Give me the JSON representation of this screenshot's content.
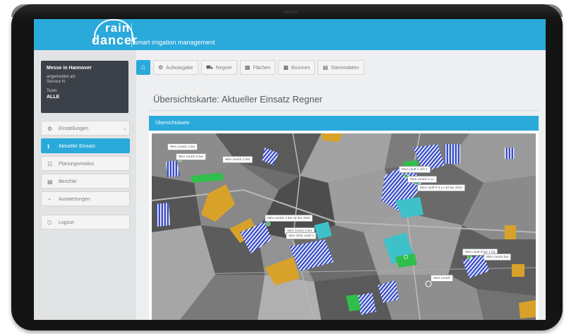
{
  "app": {
    "logo_top": "rain",
    "logo_bottom": "dancer",
    "tagline": "smart irrigation management"
  },
  "user": {
    "title": "Messe in Hannover",
    "sub1": "angemeldet als",
    "sub2": "Service N",
    "team_label": "Team",
    "team": "ALLE"
  },
  "sidebar": {
    "items": [
      {
        "label": "Einstellungen",
        "icon": "gear-icon",
        "glyph": "⚙",
        "active": false,
        "chevron": "‹"
      },
      {
        "label": "Aktueller Einsatz",
        "icon": "info-icon",
        "glyph": "ℹ",
        "active": true,
        "chevron": ""
      },
      {
        "label": "Planungsmodus",
        "icon": "grid-icon",
        "glyph": "☷",
        "active": false,
        "chevron": ""
      },
      {
        "label": "Berichte",
        "icon": "report-icon",
        "glyph": "▤",
        "active": false,
        "chevron": ""
      },
      {
        "label": "Auswertungen",
        "icon": "chart-icon",
        "glyph": "◔",
        "active": false,
        "chevron": ""
      }
    ],
    "logout": {
      "label": "Logout",
      "icon": "logout-icon",
      "glyph": "⎋"
    }
  },
  "toolbar": {
    "home_icon": "home-icon",
    "home_glyph": "⌂",
    "buttons": [
      {
        "label": "Aufwasgabe",
        "icon": "settings-icon",
        "glyph": "⚙"
      },
      {
        "label": "Regner",
        "icon": "tractor-icon",
        "glyph": "⛟"
      },
      {
        "label": "Flächen",
        "icon": "field-icon",
        "glyph": "▦"
      },
      {
        "label": "Brunnen",
        "icon": "well-icon",
        "glyph": "▦"
      },
      {
        "label": "Stammdaten",
        "icon": "database-icon",
        "glyph": "▤"
      }
    ]
  },
  "page": {
    "title": "Übersichtskarte: Aktueller Einsatz Regner",
    "panel_title": "Übersichtskarte"
  },
  "map": {
    "labels": [
      "Wen zurück 1 bar",
      "Wen zurück 2 bar",
      "Wen zurück 3 bar",
      "Wen Läuft 1 m/h 2",
      "Wen zurück 4 Lu",
      "Wen Läuft P 3 Lu 40 bar 2024",
      "Wen zurück 1 bar 40 bar 2024",
      "Wen zurück 2 bar",
      "Wen 2024 Läuft 1",
      "Wen Läuft 5 bar 1 Kg",
      "Wen zurück",
      "Wen zurück bar"
    ],
    "colors": {
      "satellite_dark": "#4a4a4a",
      "satellite_light": "#9a9a9a",
      "field_orange": "#d8a22a",
      "field_blue": "#3a4fc7",
      "field_cyan": "#3ec1c9",
      "field_green": "#2fbf4a"
    }
  }
}
